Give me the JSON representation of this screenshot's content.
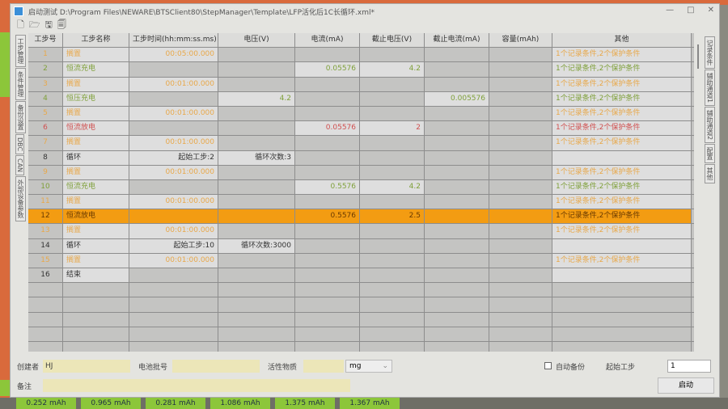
{
  "window": {
    "title": "启动测试 D:\\Program Files\\NEWARE\\BTSClient80\\StepManager\\Template\\LFP活化后1C长循环.xml*",
    "min": "—",
    "max": "□",
    "close": "✕"
  },
  "toolbar": [
    "🗋",
    "🗁",
    "🖫",
    "🗐"
  ],
  "left_tabs": [
    "工步管理",
    "条件管理",
    "备份设置",
    "DBC",
    "CAN",
    "外部设备参数"
  ],
  "right_tabs": [
    "记录条件",
    "辅助通道1",
    "辅助通道2",
    "配置",
    "其他"
  ],
  "columns": [
    "工步号",
    "工步名称",
    "工步时间(hh:mm:ss.ms)",
    "电压(V)",
    "电流(mA)",
    "截止电压(V)",
    "截止电流(mA)",
    "容量(mAh)",
    "其他"
  ],
  "colors": {
    "rest": "#e8a84a",
    "charge": "#7fa03a",
    "discharge": "#d05050",
    "cycle": "#333333",
    "selected": "#f39c12"
  },
  "rows": [
    {
      "n": "1",
      "name": "搁置",
      "type": "rest",
      "time": "00:05:00.000",
      "v": "",
      "i": "",
      "cv": "",
      "ci": "",
      "cap": "",
      "other": "1个记录条件,2个保护条件"
    },
    {
      "n": "2",
      "name": "恒流充电",
      "type": "charge",
      "time": "",
      "v": "",
      "i": "0.05576",
      "cv": "4.2",
      "ci": "",
      "cap": "",
      "other": "1个记录条件,2个保护条件"
    },
    {
      "n": "3",
      "name": "搁置",
      "type": "rest",
      "time": "00:01:00.000",
      "v": "",
      "i": "",
      "cv": "",
      "ci": "",
      "cap": "",
      "other": "1个记录条件,2个保护条件"
    },
    {
      "n": "4",
      "name": "恒压充电",
      "type": "charge",
      "time": "",
      "v": "4.2",
      "i": "",
      "cv": "",
      "ci": "0.005576",
      "cap": "",
      "other": "1个记录条件,2个保护条件"
    },
    {
      "n": "5",
      "name": "搁置",
      "type": "rest",
      "time": "00:01:00.000",
      "v": "",
      "i": "",
      "cv": "",
      "ci": "",
      "cap": "",
      "other": "1个记录条件,2个保护条件"
    },
    {
      "n": "6",
      "name": "恒流放电",
      "type": "discharge",
      "time": "",
      "v": "",
      "i": "0.05576",
      "cv": "2",
      "ci": "",
      "cap": "",
      "other": "1个记录条件,2个保护条件"
    },
    {
      "n": "7",
      "name": "搁置",
      "type": "rest",
      "time": "00:01:00.000",
      "v": "",
      "i": "",
      "cv": "",
      "ci": "",
      "cap": "",
      "other": "1个记录条件,2个保护条件"
    },
    {
      "n": "8",
      "name": "循环",
      "type": "cycle",
      "time": "起始工步:2",
      "v": "循环次数:3",
      "i": "",
      "cv": "",
      "ci": "",
      "cap": "",
      "other": ""
    },
    {
      "n": "9",
      "name": "搁置",
      "type": "rest",
      "time": "00:01:00.000",
      "v": "",
      "i": "",
      "cv": "",
      "ci": "",
      "cap": "",
      "other": "1个记录条件,2个保护条件"
    },
    {
      "n": "10",
      "name": "恒流充电",
      "type": "charge",
      "time": "",
      "v": "",
      "i": "0.5576",
      "cv": "4.2",
      "ci": "",
      "cap": "",
      "other": "1个记录条件,2个保护条件"
    },
    {
      "n": "11",
      "name": "搁置",
      "type": "rest",
      "time": "00:01:00.000",
      "v": "",
      "i": "",
      "cv": "",
      "ci": "",
      "cap": "",
      "other": "1个记录条件,2个保护条件"
    },
    {
      "n": "12",
      "name": "恒流放电",
      "type": "discharge",
      "time": "",
      "v": "",
      "i": "0.5576",
      "cv": "2.5",
      "ci": "",
      "cap": "",
      "other": "1个记录条件,2个保护条件",
      "selected": true
    },
    {
      "n": "13",
      "name": "搁置",
      "type": "rest",
      "time": "00:01:00.000",
      "v": "",
      "i": "",
      "cv": "",
      "ci": "",
      "cap": "",
      "other": "1个记录条件,2个保护条件"
    },
    {
      "n": "14",
      "name": "循环",
      "type": "cycle",
      "time": "起始工步:10",
      "v": "循环次数:3000",
      "i": "",
      "cv": "",
      "ci": "",
      "cap": "",
      "other": ""
    },
    {
      "n": "15",
      "name": "搁置",
      "type": "rest",
      "time": "00:01:00.000",
      "v": "",
      "i": "",
      "cv": "",
      "ci": "",
      "cap": "",
      "other": "1个记录条件,2个保护条件"
    },
    {
      "n": "16",
      "name": "结束",
      "type": "cycle",
      "time": "",
      "v": "",
      "i": "",
      "cv": "",
      "ci": "",
      "cap": "",
      "other": ""
    }
  ],
  "bottom": {
    "creator_label": "创建者",
    "creator": "HJ",
    "batch_label": "电池批号",
    "batch": "",
    "material_label": "活性物质",
    "material": "",
    "unit": "mg",
    "auto_backup": "自动备份",
    "start_step_label": "起始工步",
    "start_step": "1",
    "start_button": "启动",
    "remark_label": "备注",
    "remark": ""
  },
  "background_values": [
    "0.252 mAh",
    "0.965 mAh",
    "0.281 mAh",
    "1.086 mAh",
    "1.375 mAh",
    "1.367 mAh"
  ]
}
